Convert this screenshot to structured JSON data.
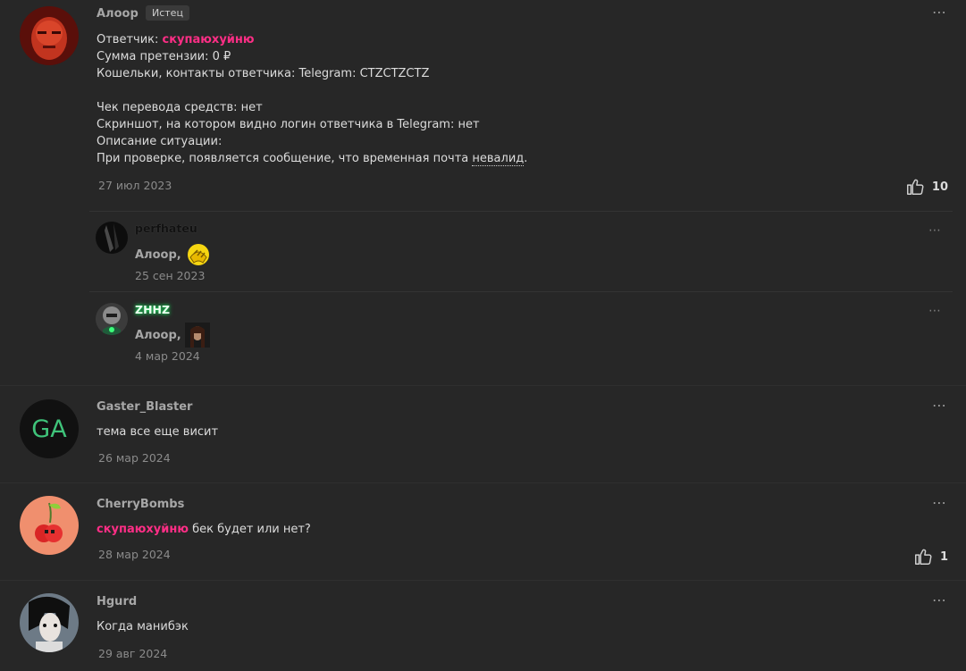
{
  "posts": [
    {
      "author": "Алоор",
      "badge": "Истец",
      "lines": {
        "defendant_label": "Ответчик: ",
        "defendant_name": "скупаюхуйню",
        "claim": "Сумма претензии: 0 ₽",
        "wallets": "Кошельки, контакты ответчика: Telegram: CTZCTZCTZ",
        "receipt": "Чек перевода средств: нет",
        "screenshot": "Скриншот, на котором видно логин ответчика в Telegram: нет",
        "description_label": "Описание ситуации:",
        "description_text": "При проверке, появляется сообщение, что временная почта ",
        "description_link": "невалид",
        "description_end": "."
      },
      "date": "27 июл 2023",
      "likes": "10",
      "replies": [
        {
          "author": "perfhateu",
          "text": "Алоор,",
          "date": "25 сен 2023"
        },
        {
          "author": "ZHHZ",
          "text": "Алоор,",
          "date": "4 мар 2024"
        }
      ]
    },
    {
      "author": "Gaster_Blaster",
      "avatar_initials": "GA",
      "text": "тема все еще висит",
      "date": "26 мар 2024"
    },
    {
      "author": "CherryBombs",
      "mention": "скупаюхуйню",
      "text": " бек будет или нет?",
      "date": "28 мар 2024",
      "likes": "1"
    },
    {
      "author": "Hgurd",
      "text": "Когда манибэк",
      "date": "29 авг 2024"
    }
  ],
  "icons": {
    "menu": "⋯"
  },
  "colors": {
    "background": "#272727",
    "mention": "#ff2e86",
    "zhhz_name": "#4dff84"
  }
}
